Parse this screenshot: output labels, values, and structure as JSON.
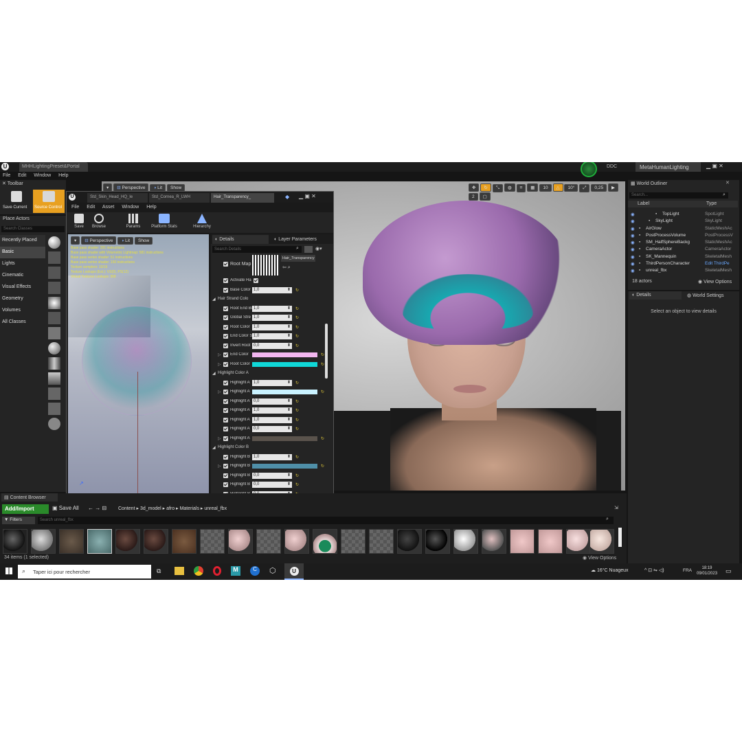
{
  "app": {
    "title": "MHHLightingPreset&Portal",
    "project": "MetaHumanLighting",
    "ddc": "DDC"
  },
  "main_menu": [
    "File",
    "Edit",
    "Window",
    "Help"
  ],
  "toolbar": {
    "title": "Toolbar",
    "save_current": "Save Current",
    "source_control": "Source Control"
  },
  "place_actors": {
    "title": "Place Actors",
    "search_placeholder": "Search Classes",
    "categories": [
      "Recently Placed",
      "Basic",
      "Lights",
      "Cinematic",
      "Visual Effects",
      "Geometry",
      "Volumes",
      "All Classes"
    ]
  },
  "viewport": {
    "perspective": "Perspective",
    "lit": "Lit",
    "show": "Show",
    "snap": "10",
    "angle": "10°",
    "scale": "0,25",
    "cams": "2"
  },
  "material_editor": {
    "tabs": [
      "Std_Skin_Head_HQ_le",
      "Std_Cornea_R_LWH",
      "Hair_Transparency_"
    ],
    "menu": [
      "File",
      "Edit",
      "Asset",
      "Window",
      "Help"
    ],
    "tools": [
      "Save",
      "Browse",
      "Params",
      "Platform Stats",
      "Hierarchy"
    ],
    "preview": {
      "perspective": "Perspective",
      "lit": "Lit",
      "show": "Show",
      "stats": [
        "Base pass shader: 391 instructions",
        "Base pass shader with Volumetric Lightmap: 581 instructions",
        "Base pass vertex shader: 51 instructions",
        "Base pass vertex shader: 150 instructions",
        "Texture samplers: 10/16",
        "Texture Lookups (Est.): VS(0), PS(12)",
        "Virtual Textures Lookups: 368"
      ]
    }
  },
  "details": {
    "tab_details": "Details",
    "tab_layers": "Layer Parameters",
    "search_placeholder": "Search Details",
    "root_map_label": "Root Map",
    "root_map_asset": "Hair_Transparency",
    "rows": [
      {
        "type": "value",
        "label": "Activate Ha",
        "value": ""
      },
      {
        "type": "value",
        "label": "Base Color",
        "value": "1,0"
      },
      {
        "type": "group",
        "label": "Hair Strand Colo"
      },
      {
        "type": "value",
        "label": "Root End Bl",
        "value": "1,0"
      },
      {
        "type": "value",
        "label": "Global Stre",
        "value": "1,0"
      },
      {
        "type": "value",
        "label": "Root Color",
        "value": "1,0"
      },
      {
        "type": "value",
        "label": "End Color S",
        "value": "1,0"
      },
      {
        "type": "value",
        "label": "Invert Root",
        "value": "0,0"
      },
      {
        "type": "color",
        "label": "End Color",
        "color": "#f2b6f0"
      },
      {
        "type": "color",
        "label": "Root Color",
        "color": "#10d8d8"
      },
      {
        "type": "group",
        "label": "Highlight Color A"
      },
      {
        "type": "value",
        "label": "Highlight A",
        "value": "1,0"
      },
      {
        "type": "color",
        "label": "Highlight A",
        "color": "#c9f2ff"
      },
      {
        "type": "value",
        "label": "Highlight A",
        "value": "0,0"
      },
      {
        "type": "value",
        "label": "Highlight A",
        "value": "1,0"
      },
      {
        "type": "value",
        "label": "Highlight A",
        "value": "1,0"
      },
      {
        "type": "value",
        "label": "Highlight A",
        "value": "0,0"
      },
      {
        "type": "color",
        "label": "Highlight A",
        "color": "#5a534c"
      },
      {
        "type": "group",
        "label": "Highlight Color B"
      },
      {
        "type": "value",
        "label": "Highlight B",
        "value": "1,0"
      },
      {
        "type": "color",
        "label": "Highlight B",
        "color": "#4f8fa8"
      },
      {
        "type": "value",
        "label": "Highlight B",
        "value": "0,0"
      },
      {
        "type": "value",
        "label": "Highlight B",
        "value": "0,0"
      },
      {
        "type": "value",
        "label": "Highlight B",
        "value": "0,0"
      }
    ]
  },
  "outliner": {
    "title": "World Outliner",
    "search_placeholder": "Search...",
    "col_label": "Label",
    "col_type": "Type",
    "items": [
      {
        "label": "TopLight",
        "type": "SpotLight"
      },
      {
        "label": "SkyLight",
        "type": "SkyLight"
      },
      {
        "label": "AirGlow",
        "type": "StaticMeshAc"
      },
      {
        "label": "PostProcessVolume",
        "type": "PostProcessV"
      },
      {
        "label": "SM_HalfSphereBackg",
        "type": "StaticMeshAc"
      },
      {
        "label": "CameraActor",
        "type": "CameraActor"
      },
      {
        "label": "SK_Mannequin",
        "type": "SkeletalMesh"
      },
      {
        "label": "ThirdPersonCharacter",
        "type": "Edit ThirdPe"
      },
      {
        "label": "unreal_fbx",
        "type": "SkeletalMesh"
      }
    ],
    "count": "18 actors",
    "view_options": "View Options"
  },
  "details_panel": {
    "tab_details": "Details",
    "tab_world": "World Settings",
    "empty": "Select an object to view details"
  },
  "content_browser": {
    "title": "Content Browser",
    "add_import": "Add/Import",
    "save_all": "Save All",
    "path": [
      "Content",
      "3d_model",
      "afro",
      "Materials",
      "unreal_fbx"
    ],
    "filters": "Filters",
    "search_placeholder": "Search unreal_fbx",
    "status": "34 items (1 selected)",
    "view_options": "View Options"
  },
  "taskbar": {
    "search_placeholder": "Taper ici pour rechercher",
    "weather": "16°C  Nuageux",
    "lang": "FRA",
    "time": "18:19",
    "date": "09/01/2023"
  },
  "colors": {
    "accent": "#e8a020",
    "panel": "#242424",
    "selection": "#2f5fa0"
  }
}
